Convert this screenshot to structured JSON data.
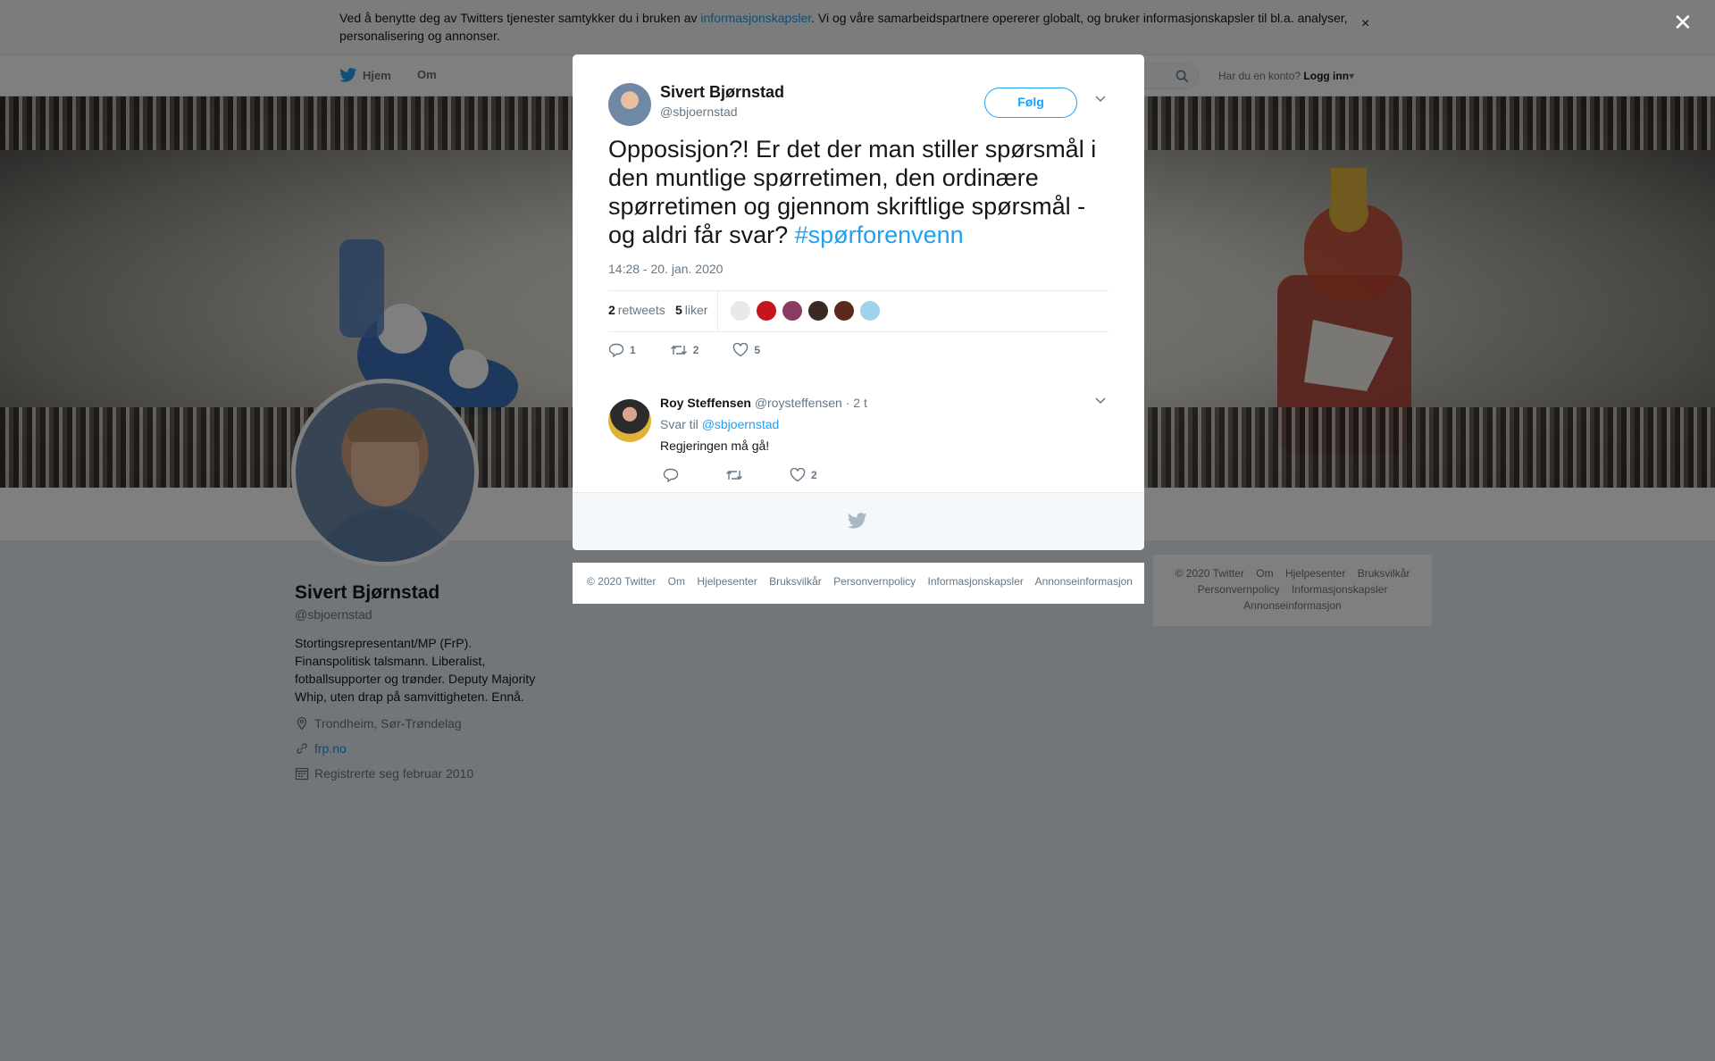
{
  "cookie_bar": {
    "text_before": "Ved å benytte deg av Twitters tjenester samtykker du i bruken av ",
    "link": "informasjonskapsler",
    "text_after": ". Vi og våre samarbeidspartnere opererer globalt, og bruker informasjonskapsler til bl.a. analyser, personalisering og annonser.",
    "close": "×"
  },
  "nav": {
    "home": "Hjem",
    "about": "Om",
    "login_prompt": "Har du en konto?",
    "login": "Logg inn"
  },
  "profile": {
    "name": "Sivert Bjørnstad",
    "handle": "@sbjoernstad",
    "bio": "Stortingsrepresentant/MP (FrP). Finanspolitisk talsmann. Liberalist, fotballsupporter og trønder. Deputy Majority Whip, uten drap på samvittigheten. Ennå.",
    "location": "Trondheim, Sør-Trøndelag",
    "url": "frp.no",
    "joined": "Registrerte seg februar 2010"
  },
  "right_footer": {
    "links": [
      "© 2020 Twitter",
      "Om",
      "Hjelpesenter",
      "Bruksvilkår",
      "Personvernpolicy",
      "Informasjonskapsler",
      "Annonseinformasjon"
    ]
  },
  "overlay": {
    "close": "✕"
  },
  "modal": {
    "author_name": "Sivert Bjørnstad",
    "author_handle": "@sbjoernstad",
    "follow_label": "Følg",
    "tweet_text": "Opposisjon?! Er det der man stiller spørsmål i den muntlige spørretimen, den ordinære spørretimen og gjennom skriftlige spørsmål - og aldri får svar? ",
    "hashtag": "#spørforenvenn",
    "timestamp": "14:28 - 20. jan. 2020",
    "retweets_count": "2",
    "retweets_label": "retweets",
    "likes_count": "5",
    "likes_label": "liker",
    "likers": [
      "#e8e8e8",
      "#c4161c",
      "#8b3a62",
      "#3a2a22",
      "#5a2a1e",
      "#9fd3ec"
    ],
    "actions": {
      "reply": "1",
      "retweet": "2",
      "like": "5"
    },
    "reply": {
      "name": "Roy Steffensen",
      "handle": "@roysteffensen",
      "time": "· 2 t",
      "reply_to_label": "Svar til ",
      "reply_to_handle": "@sbjoernstad",
      "text": "Regjeringen må gå!",
      "actions": {
        "reply": "",
        "retweet": "",
        "like": "2"
      }
    }
  },
  "modal_links": [
    "© 2020 Twitter",
    "Om",
    "Hjelpesenter",
    "Bruksvilkår",
    "Personvernpolicy",
    "Informasjonskapsler",
    "Annonseinformasjon"
  ],
  "colors": {
    "accent": "#1da1f2",
    "secondary_text": "#657786"
  }
}
